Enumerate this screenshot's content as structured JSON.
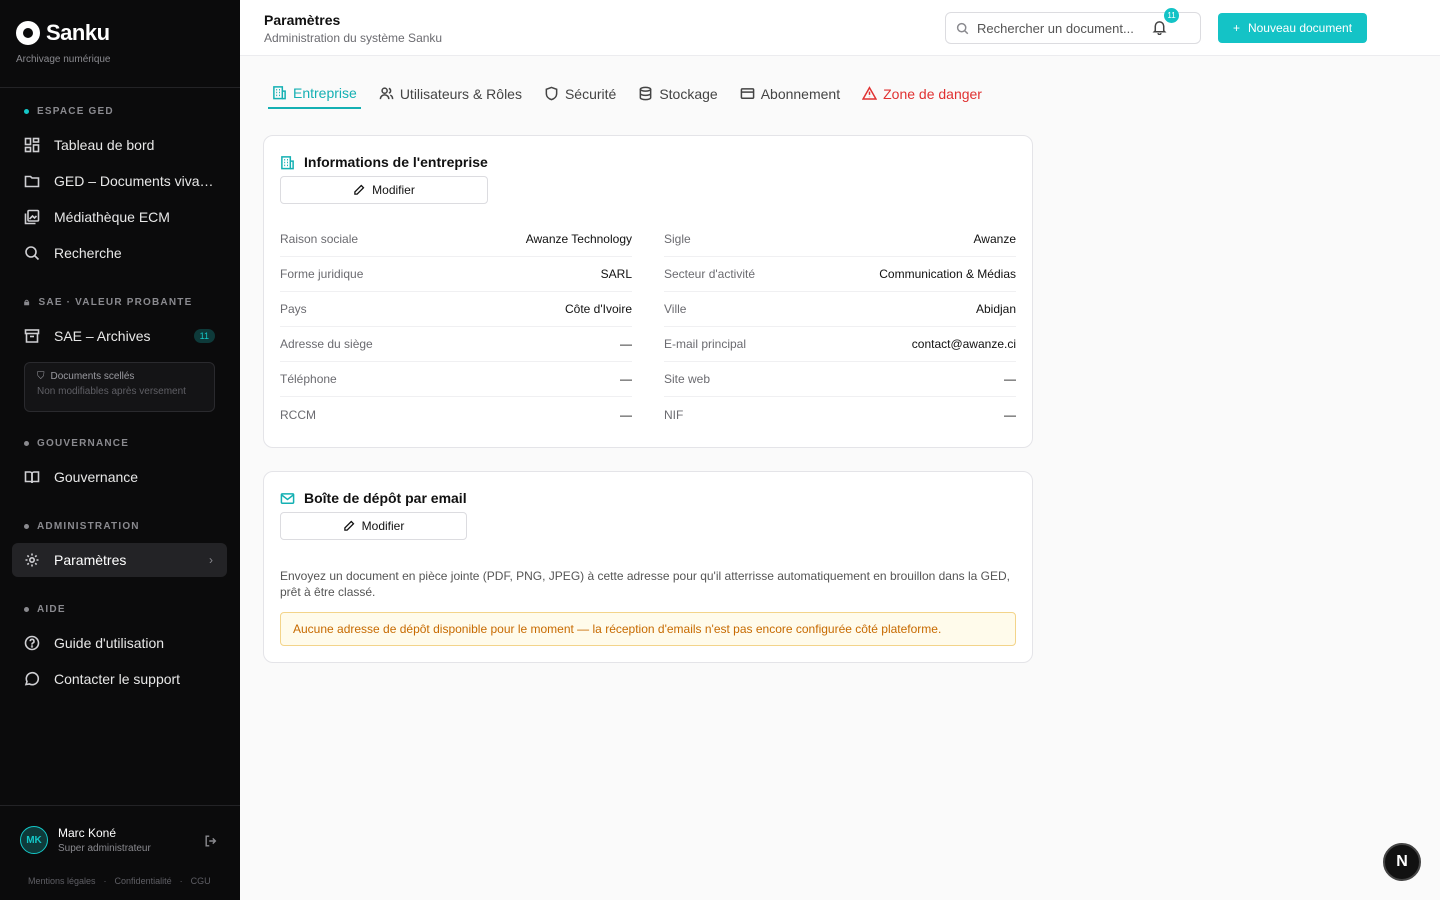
{
  "brand": {
    "name": "Sanku",
    "tagline": "Archivage numérique"
  },
  "sidebar": {
    "sections": [
      {
        "label": "ESPACE GED"
      },
      {
        "label": "SAE · VALEUR PROBANTE"
      },
      {
        "label": "GOUVERNANCE"
      },
      {
        "label": "ADMINISTRATION"
      },
      {
        "label": "AIDE"
      }
    ],
    "items": [
      {
        "label": "Tableau de bord",
        "icon": "dashboard-icon"
      },
      {
        "label": "GED – Documents vivants",
        "icon": "folder-icon"
      },
      {
        "label": "Médiathèque ECM",
        "icon": "media-icon"
      },
      {
        "label": "Recherche",
        "icon": "search-icon"
      },
      {
        "label": "SAE – Archives",
        "icon": "archive-icon",
        "badge": "11"
      },
      {
        "label": "Gouvernance",
        "icon": "book-icon"
      },
      {
        "label": "Paramètres",
        "icon": "gear-icon",
        "active": true
      },
      {
        "label": "Guide d'utilisation",
        "icon": "help-icon"
      },
      {
        "label": "Contacter le support",
        "icon": "chat-icon"
      }
    ],
    "sealed": {
      "title": "Documents scellés",
      "subtitle": "Non modifiables après versement"
    },
    "user": {
      "initials": "MK",
      "name": "Marc Koné",
      "role": "Super administrateur"
    },
    "legal": [
      "Mentions légales",
      "Confidentialité",
      "CGU"
    ]
  },
  "header": {
    "title": "Paramètres",
    "subtitle": "Administration du système Sanku",
    "search_placeholder": "Rechercher un document...",
    "new_button": "Nouveau document",
    "notif_count": "11"
  },
  "tabs": [
    {
      "label": "Entreprise",
      "active": true
    },
    {
      "label": "Utilisateurs & Rôles"
    },
    {
      "label": "Sécurité"
    },
    {
      "label": "Stockage"
    },
    {
      "label": "Abonnement"
    },
    {
      "label": "Zone de danger",
      "danger": true
    }
  ],
  "company_card": {
    "title": "Informations de l'entreprise",
    "edit_label": "Modifier",
    "left": [
      {
        "label": "Raison sociale",
        "value": "Awanze Technology"
      },
      {
        "label": "Forme juridique",
        "value": "SARL"
      },
      {
        "label": "Pays",
        "value": "Côte d'Ivoire"
      },
      {
        "label": "Adresse du siège",
        "value": "—"
      },
      {
        "label": "Téléphone",
        "value": "—"
      },
      {
        "label": "RCCM",
        "value": "—"
      }
    ],
    "right": [
      {
        "label": "Sigle",
        "value": "Awanze"
      },
      {
        "label": "Secteur d'activité",
        "value": "Communication & Médias"
      },
      {
        "label": "Ville",
        "value": "Abidjan"
      },
      {
        "label": "E-mail principal",
        "value": "contact@awanze.ci"
      },
      {
        "label": "Site web",
        "value": "—"
      },
      {
        "label": "NIF",
        "value": "—"
      }
    ]
  },
  "mail_card": {
    "title": "Boîte de dépôt par email",
    "edit_label": "Modifier",
    "description": "Envoyez un document en pièce jointe (PDF, PNG, JPEG) à cette adresse pour qu'il atterrisse automatiquement en brouillon dans la GED, prêt à être classé.",
    "warning": "Aucune adresse de dépôt disponible pour le moment — la réception d'emails n'est pas encore configurée côté plateforme."
  },
  "fab_label": "N",
  "colors": {
    "accent": "#14c3c6",
    "danger": "#e03131",
    "sidebar_bg": "#0b0b0c"
  }
}
